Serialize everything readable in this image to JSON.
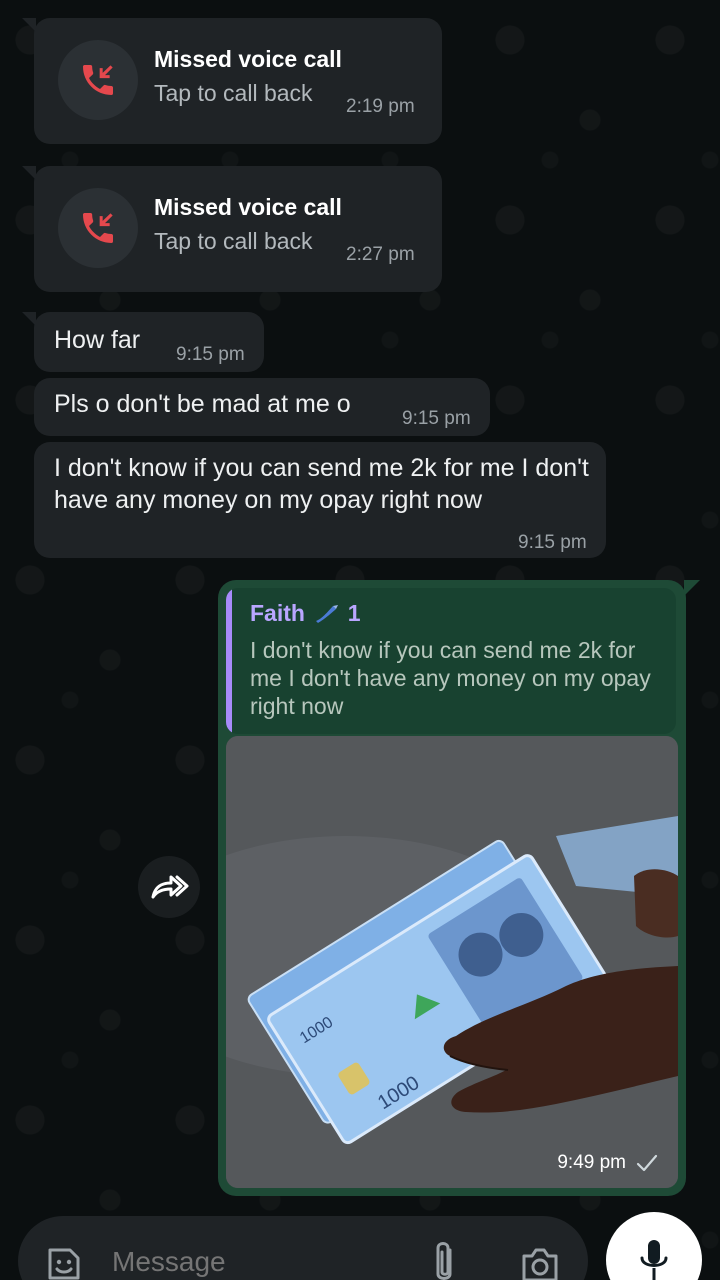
{
  "chat": {
    "calls": [
      {
        "title": "Missed voice call",
        "subtitle": "Tap to call back",
        "time": "2:19 pm"
      },
      {
        "title": "Missed voice call",
        "subtitle": "Tap to call back",
        "time": "2:27 pm"
      }
    ],
    "messages": [
      {
        "text": "How far",
        "time": "9:15 pm"
      },
      {
        "text": "Pls o don't be mad at me o",
        "time": "9:15 pm"
      },
      {
        "text": "I don't know if you can send me 2k for me I don't have any money on my opay right now",
        "time": "9:15 pm"
      }
    ],
    "reply": {
      "quoted_name": "Faith",
      "quoted_name_suffix": "1",
      "quoted_text": "I don't know if you can send me 2k for me I don't have any money on my opay right now",
      "time": "9:49 pm"
    }
  },
  "composer": {
    "placeholder": "Message"
  },
  "colors": {
    "missed_call_red": "#e5484d",
    "outgoing_bubble": "#1e4a36",
    "accent_quote": "#b9a6ff"
  }
}
